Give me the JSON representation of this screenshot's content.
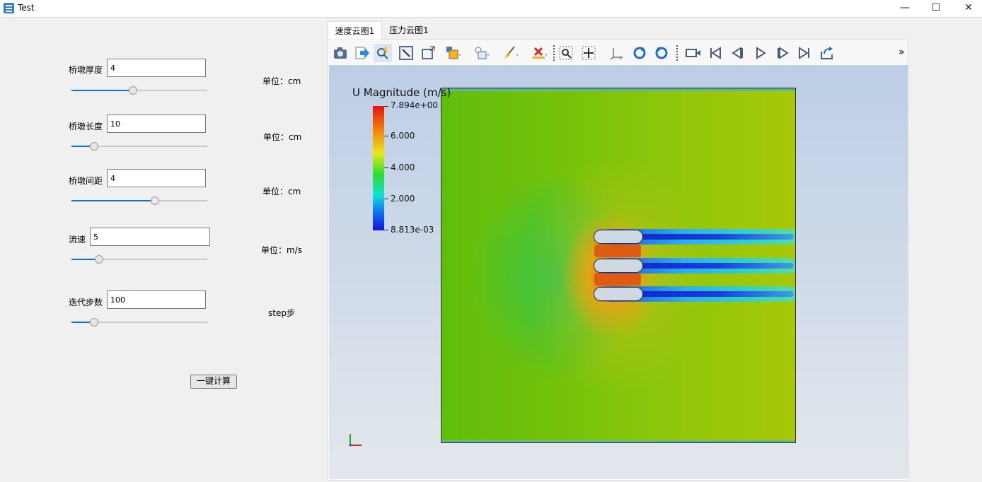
{
  "window": {
    "title": "Test",
    "icon": "app-icon",
    "controls": [
      "minimize",
      "maximize",
      "close"
    ]
  },
  "params": [
    {
      "label": "桥墩厚度",
      "value": "4",
      "unit": "单位：cm",
      "slider": 0.45
    },
    {
      "label": "桥墩长度",
      "value": "10",
      "unit": "单位：cm",
      "slider": 0.16
    },
    {
      "label": "桥墩间距",
      "value": "4",
      "unit": "单位：cm",
      "slider": 0.61
    },
    {
      "label": "流速",
      "value": "5",
      "unit": "单位：m/s",
      "slider": 0.2
    },
    {
      "label": "迭代步数",
      "value": "100",
      "unit": "step步",
      "slider": 0.16
    }
  ],
  "calc_button": "一键计算",
  "tabs": [
    {
      "label": "速度云图1",
      "active": true
    },
    {
      "label": "压力云图1",
      "active": false
    }
  ],
  "toolbar": {
    "icons": [
      "camera-icon",
      "export-icon",
      "query-icon",
      "reset-camera-icon",
      "zoom-box-icon",
      "color-map-icon",
      "filter-icon",
      "brush-icon",
      "clear-selection-icon",
      "zoom-to-selection-icon",
      "pan-icon",
      "axes-icon",
      "rotate-cw-icon",
      "rotate-ccw-icon",
      "record-icon",
      "first-frame-icon",
      "prev-frame-icon",
      "play-icon",
      "next-frame-icon",
      "last-frame-icon",
      "loop-icon"
    ],
    "more": "»"
  },
  "colorbar": {
    "title": "U Magnitude (m/s)",
    "labels": [
      "7.894e+00",
      "6.000",
      "4.000",
      "2.000",
      "8.813e-03"
    ],
    "colors": {
      "high": "#e4140c",
      "low": "#1414e0"
    }
  }
}
